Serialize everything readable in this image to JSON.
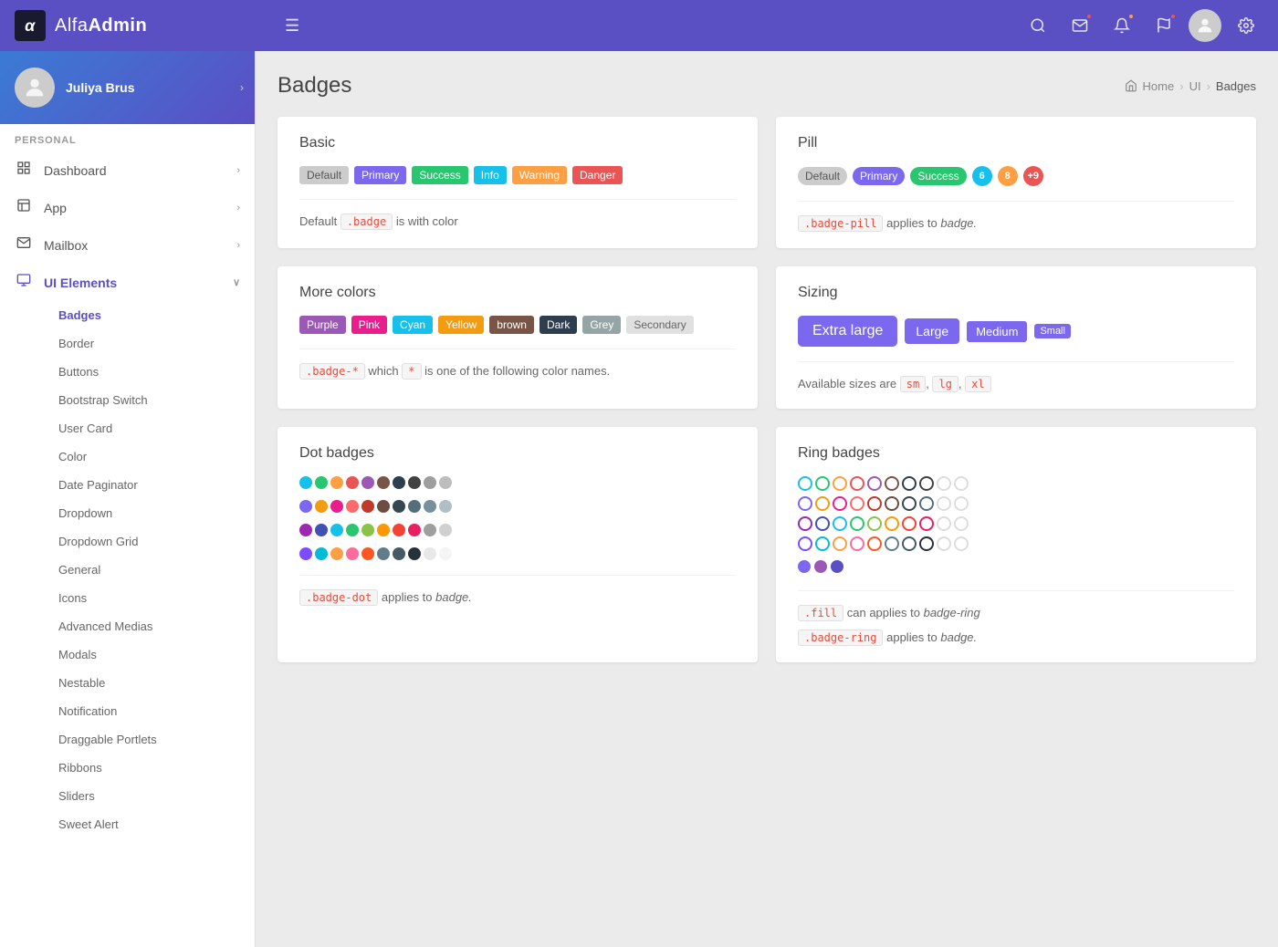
{
  "brand": {
    "alpha": "α",
    "name_light": "Alfa",
    "name_bold": "Admin"
  },
  "topnav": {
    "hamburger_label": "☰",
    "search_icon": "🔍",
    "mail_icon": "✉",
    "bell_icon": "🔔",
    "flag_icon": "⚑",
    "avatar_icon": "👤",
    "gear_icon": "⚙",
    "mail_badge_color": "#ea5455",
    "bell_badge_color": "#ff9f43",
    "flag_badge_color": "#ea5455"
  },
  "sidebar": {
    "user_name": "Juliya Brus",
    "section_personal": "PERSONAL",
    "items": [
      {
        "id": "dashboard",
        "icon": "⊞",
        "label": "Dashboard",
        "has_arrow": true
      },
      {
        "id": "app",
        "icon": "⊟",
        "label": "App",
        "has_arrow": true
      },
      {
        "id": "mailbox",
        "icon": "✉",
        "label": "Mailbox",
        "has_arrow": true
      },
      {
        "id": "ui-elements",
        "icon": "💻",
        "label": "UI Elements",
        "has_arrow": true,
        "active": true
      }
    ],
    "subitems": [
      {
        "id": "badges",
        "label": "Badges",
        "active": true
      },
      {
        "id": "border",
        "label": "Border"
      },
      {
        "id": "buttons",
        "label": "Buttons"
      },
      {
        "id": "bootstrap-switch",
        "label": "Bootstrap Switch"
      },
      {
        "id": "user-card",
        "label": "User Card"
      },
      {
        "id": "color",
        "label": "Color"
      },
      {
        "id": "date-paginator",
        "label": "Date Paginator"
      },
      {
        "id": "dropdown",
        "label": "Dropdown"
      },
      {
        "id": "dropdown-grid",
        "label": "Dropdown Grid"
      },
      {
        "id": "general",
        "label": "General"
      },
      {
        "id": "icons",
        "label": "Icons"
      },
      {
        "id": "advanced-medias",
        "label": "Advanced Medias"
      },
      {
        "id": "modals",
        "label": "Modals"
      },
      {
        "id": "nestable",
        "label": "Nestable"
      },
      {
        "id": "notification",
        "label": "Notification"
      },
      {
        "id": "draggable-portlets",
        "label": "Draggable Portlets"
      },
      {
        "id": "ribbons",
        "label": "Ribbons"
      },
      {
        "id": "sliders",
        "label": "Sliders"
      },
      {
        "id": "sweet-alert",
        "label": "Sweet Alert"
      }
    ]
  },
  "page": {
    "title": "Badges",
    "breadcrumb_home": "Home",
    "breadcrumb_ui": "UI",
    "breadcrumb_current": "Badges"
  },
  "basic": {
    "card_title": "Basic",
    "label_default": "Default",
    "badge_primary": "Primary",
    "badge_success": "Success",
    "badge_info": "Info",
    "badge_warning": "Warning",
    "badge_danger": "Danger",
    "desc_pre": "Default",
    "desc_code": ".badge",
    "desc_post": "is with color"
  },
  "pill": {
    "card_title": "Pill",
    "label_default": "Default",
    "badge_primary": "Primary",
    "badge_success": "Success",
    "badge_num1": "6",
    "badge_num2": "8",
    "badge_num3": "+9",
    "desc_code": ".badge-pill",
    "desc_mid": "applies to",
    "desc_italic": "badge."
  },
  "more_colors": {
    "card_title": "More colors",
    "badge_purple": "Purple",
    "badge_pink": "Pink",
    "badge_cyan": "Cyan",
    "badge_yellow": "Yellow",
    "badge_brown": "brown",
    "badge_dark": "Dark",
    "badge_grey": "Grey",
    "badge_secondary": "Secondary",
    "desc_code1": ".badge-*",
    "desc_mid": "which",
    "desc_code2": "*",
    "desc_post": "is one of the following color names."
  },
  "sizing": {
    "card_title": "Sizing",
    "size_xl": "Extra large",
    "size_lg": "Large",
    "size_md": "Medium",
    "size_sm": "Small",
    "desc_pre": "Available sizes are",
    "code_sm": "sm",
    "code_lg": "lg",
    "code_xl": "xl"
  },
  "dot_badges": {
    "card_title": "Dot badges",
    "desc_code": ".badge-dot",
    "desc_mid": "applies to",
    "desc_italic": "badge.",
    "colors_row1": [
      "#17c0eb",
      "#28c76f",
      "#ff9f43",
      "#ea5455",
      "#9b59b6",
      "#795548",
      "#2c3e50",
      "#424242",
      "#9e9e9e",
      "#bdbdbd"
    ],
    "colors_row2": [
      "#7b68ee",
      "#f39c12",
      "#e91e8c",
      "#ff6b6b",
      "#c0392b",
      "#6d4c41",
      "#37474f",
      "#546e7a",
      "#78909c",
      "#b0bec5"
    ],
    "colors_row3": [
      "#9c27b0",
      "#3f51b5",
      "#17c0eb",
      "#28c76f",
      "#8bc34a",
      "#ff9800",
      "#f44336",
      "#e91e63",
      "#9e9e9e",
      "#d0d0d0"
    ],
    "colors_row4": [
      "#7c4dff",
      "#00bcd4",
      "#ff9f43",
      "#ff6b9d",
      "#ff5722",
      "#607d8b",
      "#455a64",
      "#263238",
      "#e8e8e8",
      "#f5f5f5"
    ]
  },
  "ring_badges": {
    "card_title": "Ring badges",
    "desc_fill_code": ".fill",
    "desc_fill_mid": "can applies to",
    "desc_fill_italic": "badge-ring",
    "desc_ring_code": ".badge-ring",
    "desc_ring_mid": "applies to",
    "desc_ring_italic": "badge.",
    "colors_row1": [
      "#17c0eb",
      "#28c76f",
      "#ff9f43",
      "#ea5455",
      "#9b59b6",
      "#795548",
      "#2c3e50",
      "#424242",
      "#9e9e9e",
      "#bdbdbd"
    ],
    "colors_row2": [
      "#7b68ee",
      "#f39c12",
      "#e91e8c",
      "#ff6b6b",
      "#c0392b",
      "#6d4c41",
      "#37474f",
      "#546e7a",
      "#78909c",
      "#b0bec5"
    ],
    "colors_row3": [
      "#9c27b0",
      "#3f51b5",
      "#17c0eb",
      "#28c76f",
      "#8bc34a",
      "#ff9800",
      "#f44336",
      "#e91e63",
      "#9e9e9e",
      "#d0d0d0"
    ],
    "colors_row4": [
      "#7c4dff",
      "#00bcd4",
      "#ff9f43",
      "#ff6b9d",
      "#ff5722",
      "#607d8b",
      "#455a64",
      "#263238",
      "#e8e8e8",
      "#f5f5f5"
    ],
    "fill_dots": [
      "#7b68ee",
      "#9b59b6",
      "#5b4fc4"
    ]
  }
}
